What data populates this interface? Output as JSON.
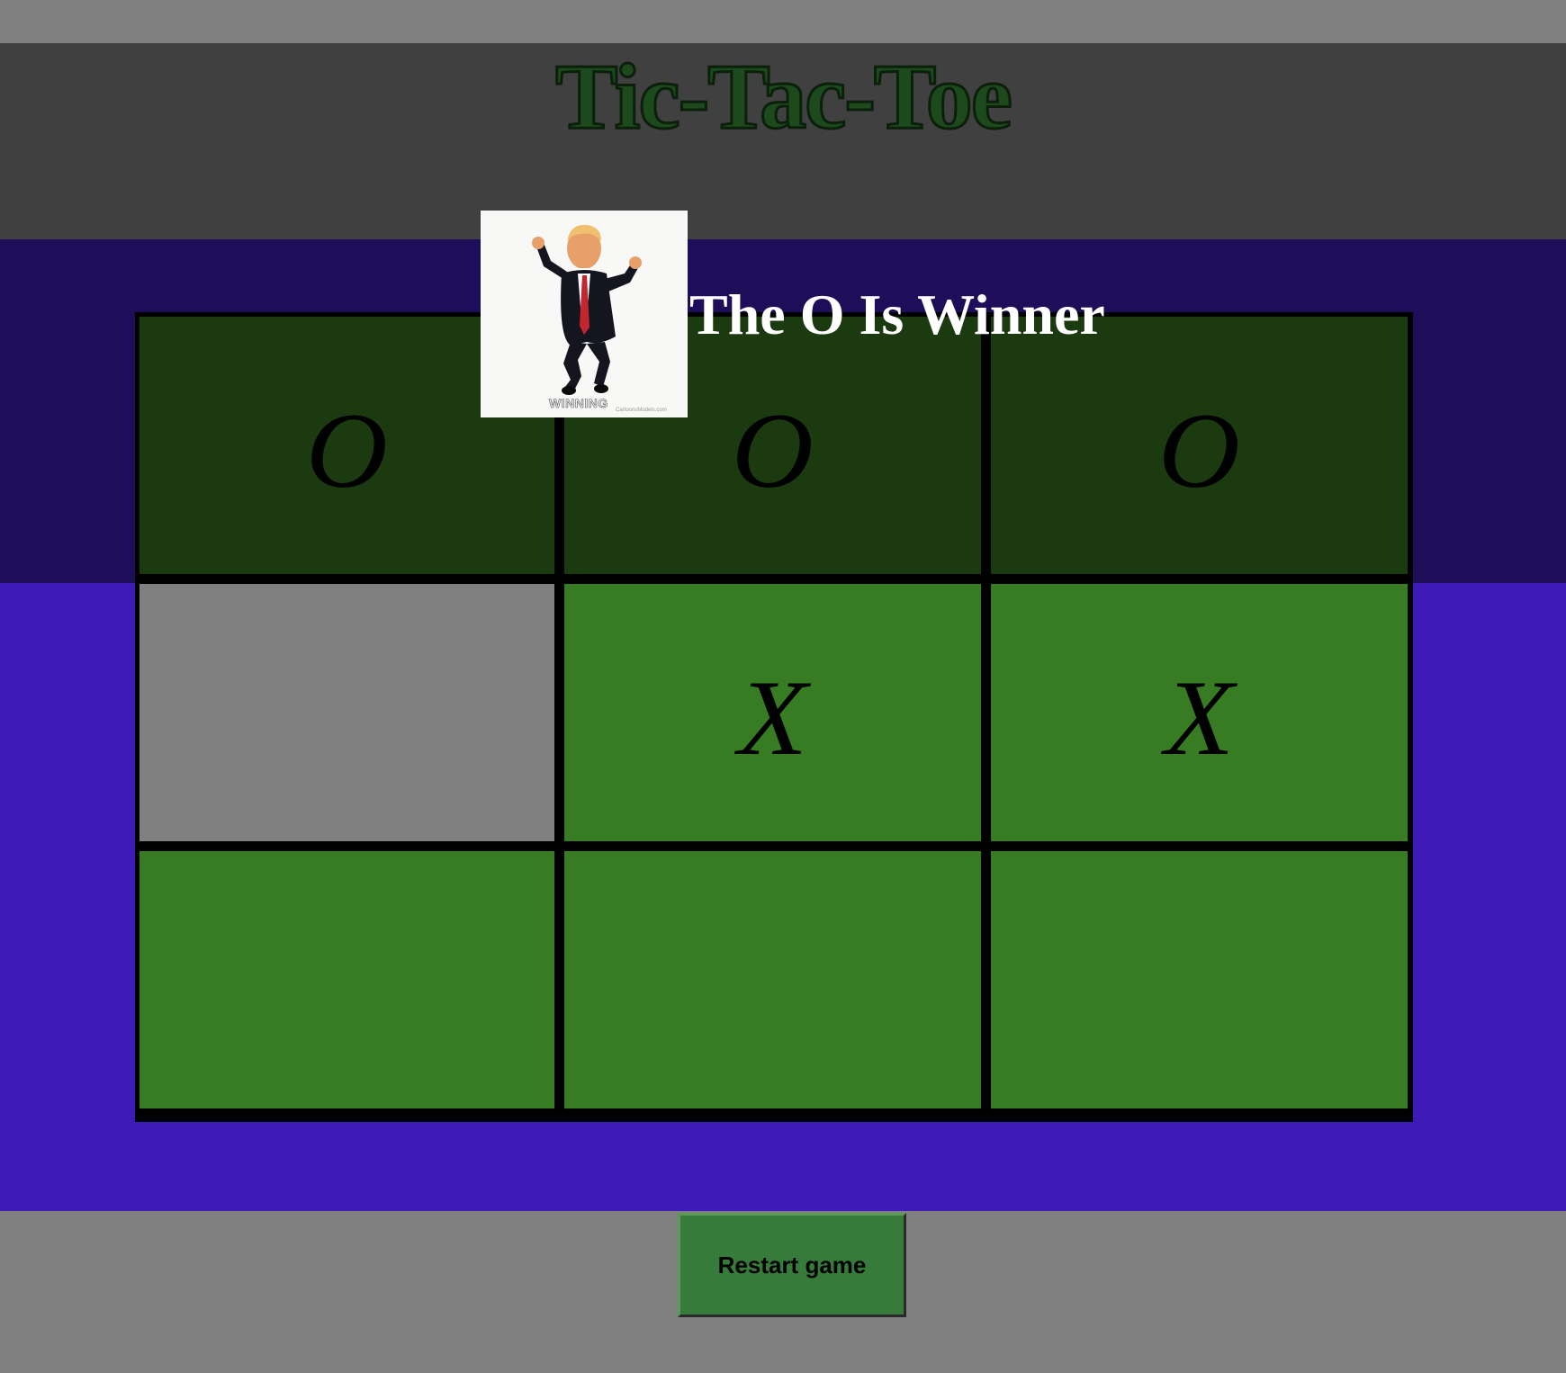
{
  "header": {
    "title": "Tic-Tac-Toe",
    "title_color": "#1c4a1c"
  },
  "winner": {
    "image_name": "dancing-trump-gif",
    "image_caption": "WINNING",
    "image_credit": "CartoonsModels.com",
    "message": "The O Is Winner"
  },
  "board": {
    "cells": [
      {
        "mark": "O",
        "state": "win"
      },
      {
        "mark": "O",
        "state": "win"
      },
      {
        "mark": "O",
        "state": "win"
      },
      {
        "mark": "",
        "state": "hover"
      },
      {
        "mark": "X",
        "state": "normal"
      },
      {
        "mark": "X",
        "state": "normal"
      },
      {
        "mark": "",
        "state": "normal"
      },
      {
        "mark": "",
        "state": "normal"
      },
      {
        "mark": "",
        "state": "normal"
      }
    ]
  },
  "controls": {
    "restart_label": "Restart game"
  },
  "colors": {
    "header_bg": "#404040",
    "band_dark": "#1e0e5a",
    "band_light": "#3e1ab8",
    "cell_win": "#1c3a0f",
    "cell_normal": "#377b22",
    "cell_hover": "#808080",
    "button_bg": "#377b3a",
    "page_bg": "#808080"
  }
}
